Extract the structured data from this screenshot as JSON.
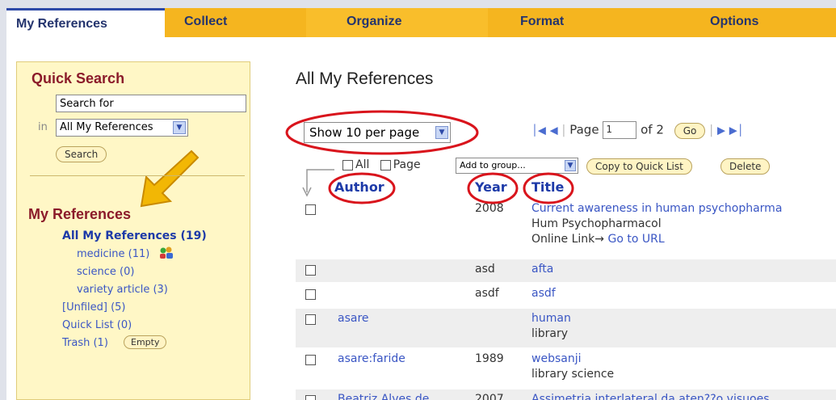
{
  "tabs": [
    {
      "label": "My References"
    },
    {
      "label": "Collect"
    },
    {
      "label": "Organize"
    },
    {
      "label": "Format"
    },
    {
      "label": "Options"
    }
  ],
  "sidebar": {
    "quick_search_title": "Quick Search",
    "search_value": "Search for",
    "in_label": "in",
    "scope_value": "All My References",
    "search_button": "Search",
    "my_refs_title": "My References",
    "all_refs": "All My References (19)",
    "groups": [
      "medicine (11)",
      "science (0)",
      "variety article (3)"
    ],
    "unfiled": "[Unfiled] (5)",
    "quick_list": "Quick List (0)",
    "trash": "Trash (1)",
    "empty_button": "Empty"
  },
  "main": {
    "heading": "All My References",
    "per_page": "Show 10 per page",
    "page_label": "Page",
    "page_value": "1",
    "page_of": "of 2",
    "go_button": "Go",
    "select_all": "All",
    "select_page": "Page",
    "group_select": "Add to group...",
    "copy_button": "Copy to Quick List",
    "delete_button": "Delete",
    "columns": {
      "author": "Author",
      "year": "Year",
      "title": "Title"
    },
    "rows": [
      {
        "author": "",
        "year": "2008",
        "title": "Current awareness in human psychopharma",
        "line2": "Hum Psychopharmacol",
        "line3_label": "Online Link",
        "line3_link": "Go to URL"
      },
      {
        "author": "",
        "year": "asd",
        "title": "afta"
      },
      {
        "author": "",
        "year": "asdf",
        "title": "asdf"
      },
      {
        "author": "asare",
        "year": "",
        "title": "human",
        "line2": "library"
      },
      {
        "author": "asare:faride",
        "year": "1989",
        "title": "websanji",
        "line2": "library science"
      },
      {
        "author": "Beatriz Alves de",
        "year": "2007",
        "title": "Assimetria interlateral da aten??o visuoes"
      }
    ]
  },
  "colors": {
    "accent": "#1d3aa8",
    "tab_yellow": "#f5b51f",
    "sidebar_bg": "#fff7c6",
    "annotation_red": "#d9141c",
    "annotation_arrow": "#f2b705"
  }
}
